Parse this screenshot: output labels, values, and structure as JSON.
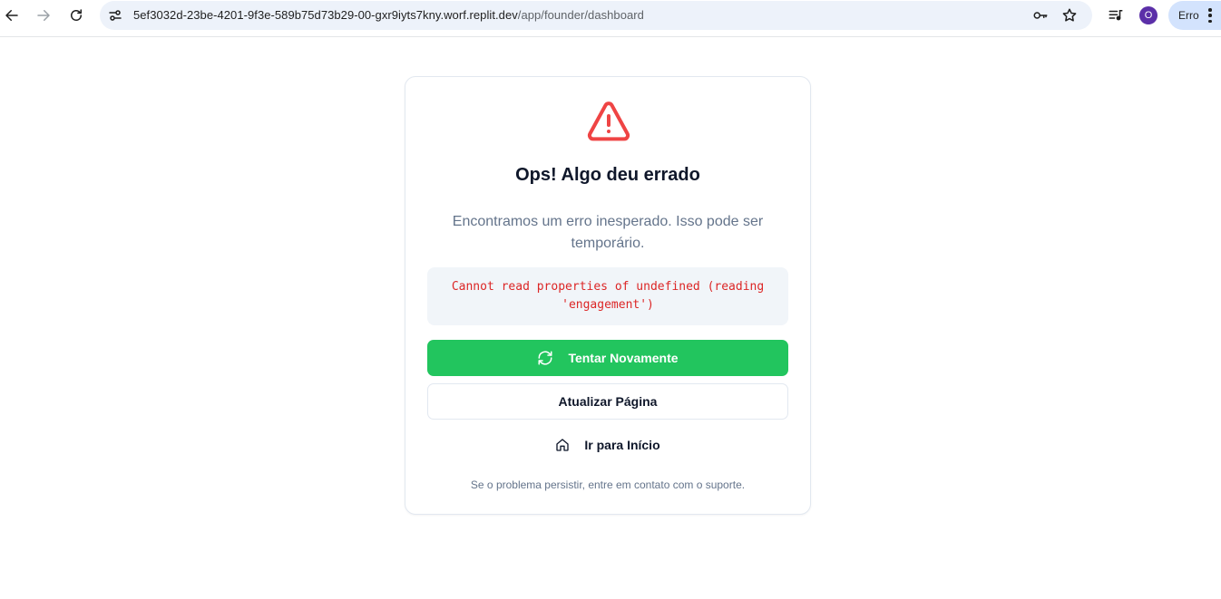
{
  "browser": {
    "url_host": "5ef3032d-23be-4201-9f3e-589b75d73b29-00-gxr9iyts7kny.worf.replit.dev",
    "url_path": "/app/founder/dashboard",
    "avatar_initial": "O",
    "profile_label": "Erro",
    "icons": [
      "back-arrow-icon",
      "forward-arrow-icon",
      "reload-icon",
      "site-info-icon",
      "password-key-icon",
      "bookmark-star-icon",
      "media-queue-icon",
      "kebab-menu-icon"
    ]
  },
  "error_card": {
    "title": "Ops! Algo deu errado",
    "description": "Encontramos um erro inesperado. Isso pode ser temporário.",
    "error_message": "Cannot read properties of undefined (reading 'engagement')",
    "retry_label": "Tentar Novamente",
    "refresh_label": "Atualizar Página",
    "home_label": "Ir para Início",
    "support_text": "Se o problema persistir, entre em contato com o suporte.",
    "icons": [
      "warning-triangle-icon",
      "refresh-cw-icon",
      "home-icon"
    ]
  },
  "colors": {
    "warning": "#ef4444",
    "error_text": "#dc2626",
    "primary_button": "#22c55e",
    "avatar": "#5b2fa8",
    "profile_chip": "#d3e3fd",
    "omnibox": "#edf2fa"
  }
}
